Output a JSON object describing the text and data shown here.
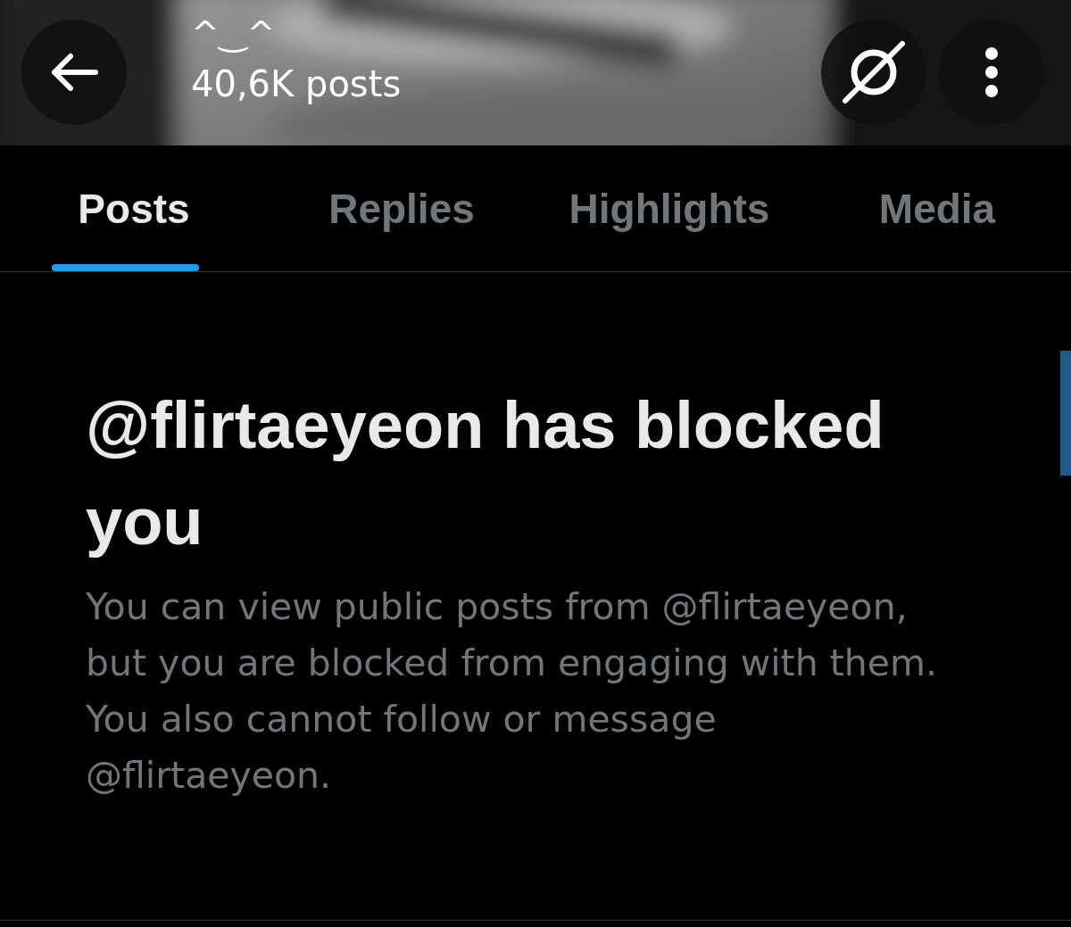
{
  "header": {
    "title": "^‿^",
    "subtitle": "40,6K posts"
  },
  "tabs": [
    {
      "label": "Posts",
      "selected": true
    },
    {
      "label": "Replies",
      "selected": false
    },
    {
      "label": "Highlights",
      "selected": false
    },
    {
      "label": "Media",
      "selected": false
    }
  ],
  "notice": {
    "title": "@flirtaeyeon has blocked you",
    "body": "You can view public posts from @flirtaeyeon, but you are blocked from engaging with them. You also cannot follow or message @flirtaeyeon."
  }
}
